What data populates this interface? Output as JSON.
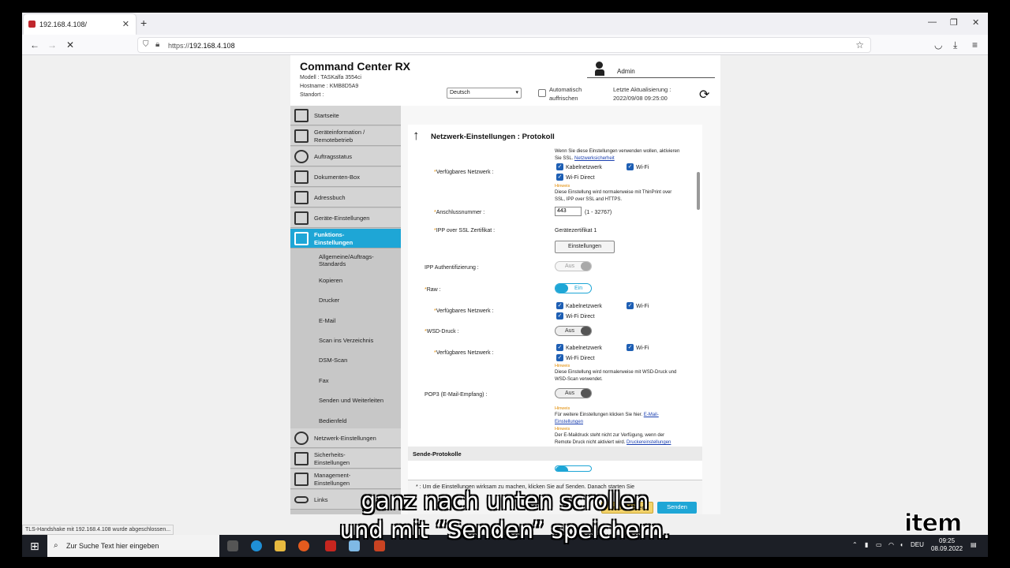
{
  "browser": {
    "tab_title": "192.168.4.108/",
    "url_prefix": "https://",
    "url_host": "192.168.4.108"
  },
  "header": {
    "brand": "Command Center RX",
    "model_label": "Modell :",
    "model_value": "TASKalfa 3554ci",
    "hostname_label": "Hostname :",
    "hostname_value": "KMB8D5A9",
    "location_label": "Standort :",
    "user": "Admin",
    "language": "Deutsch",
    "auto_refresh_line1": "Automatisch",
    "auto_refresh_line2": "auffrischen",
    "last_update_label": "Letzte Aktualisierung :",
    "last_update_value": "2022/09/08 09:25:00"
  },
  "sidebar": {
    "items": [
      {
        "label": "Startseite"
      },
      {
        "label1": "Geräteinformation /",
        "label2": "Remotebetrieb"
      },
      {
        "label": "Auftragsstatus"
      },
      {
        "label": "Dokumenten-Box"
      },
      {
        "label": "Adressbuch"
      },
      {
        "label": "Geräte-Einstellungen"
      },
      {
        "label1": "Funktions-",
        "label2": "Einstellungen"
      },
      {
        "label": "Netzwerk-Einstellungen"
      },
      {
        "label1": "Sicherheits-",
        "label2": "Einstellungen"
      },
      {
        "label1": "Management-",
        "label2": "Einstellungen"
      },
      {
        "label": "Links"
      }
    ],
    "subitems": [
      {
        "label1": "Allgemeine/Auftrags-",
        "label2": "Standards"
      },
      {
        "label": "Kopieren"
      },
      {
        "label": "Drucker"
      },
      {
        "label": "E-Mail"
      },
      {
        "label": "Scan ins Verzeichnis"
      },
      {
        "label": "DSM-Scan"
      },
      {
        "label": "Fax"
      },
      {
        "label": "Senden und Weiterleiten"
      },
      {
        "label": "Bedienfeld"
      }
    ]
  },
  "panel": {
    "title": "Netzwerk-Einstellungen : Protokoll",
    "ssl_note1": "Wenn Sie diese Einstellungen verwenden wollen, aktivieren",
    "ssl_note2_prefix": "Sie SSL.",
    "ssl_note2_link": "Netzwerksicherheit",
    "available_network": "Verfügbares Netzwerk :",
    "wired": "Kabelnetzwerk",
    "wifi": "Wi-Fi",
    "wifi_direct": "Wi-Fi Direct",
    "hint": "Hinweis",
    "ipp_note1": "Diese Einstellung wird normalerweise mit ThinPrint over",
    "ipp_note2": "SSL, IPP over SSL and HTTPS.",
    "port_label": "Anschlussnummer :",
    "port_value": "443",
    "port_range": "(1 - 32767)",
    "cert_label": "IPP over SSL Zertifikat :",
    "cert_value": "Gerätezertifikat 1",
    "settings_button": "Einstellungen",
    "ipp_auth_label": "IPP Authentifizierung :",
    "ipp_auth_value": "Aus",
    "raw_label": "Raw :",
    "raw_value": "Ein",
    "wsd_label": "WSD-Druck :",
    "wsd_value": "Aus",
    "wsd_note1": "Diese Einstellung wird normalerweise mit WSD-Druck und",
    "wsd_note2": "WSD-Scan verwendet.",
    "pop3_label": "POP3 (E-Mail-Empfang) :",
    "pop3_value": "Aus",
    "pop3_note1_prefix": "Für weitere Einstellungen klicken Sie hier.",
    "pop3_note1_link": "E-Mail-",
    "pop3_note2_link": "Einstellungen",
    "pop3_note3": "Der E-Maildruck steht nicht zur Verfügung, wenn der",
    "pop3_note4_prefix": "Remote Druck nicht aktiviert wird.",
    "pop3_note4_link": "Druckereinstellungen",
    "section_send": "Sende-Protokolle",
    "notice_line1": "* :  Um die Einstellungen wirksam zu machen, klicken Sie auf Senden. Danach starten Sie",
    "reset_button": "Zurücksetzen",
    "send_button": "Senden"
  },
  "status_bar": "TLS-Handshake mit 192.168.4.108 wurde abgeschlossen...",
  "caption": {
    "line1": "ganz nach unten scrollen",
    "line2": "und mit “Senden” speichern."
  },
  "taskbar": {
    "search_placeholder": "Zur Suche Text hier eingeben",
    "lang": "DEU",
    "time": "09:25",
    "date": "08.09.2022"
  },
  "logo": "item"
}
